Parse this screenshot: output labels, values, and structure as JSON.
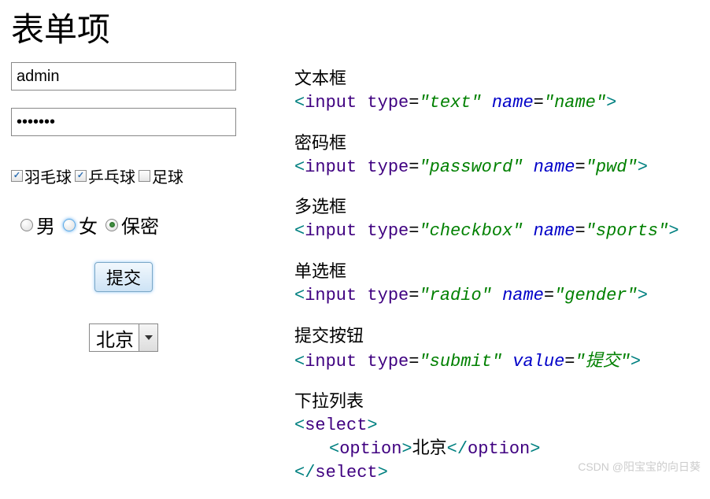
{
  "heading": "表单项",
  "form": {
    "text_value": "admin",
    "password_value": "•••••••",
    "checkboxes": [
      {
        "label": "羽毛球",
        "checked": true
      },
      {
        "label": "乒乓球",
        "checked": true
      },
      {
        "label": "足球",
        "checked": false
      }
    ],
    "radios": [
      {
        "label": "男",
        "state": "none"
      },
      {
        "label": "女",
        "state": "hover"
      },
      {
        "label": "保密",
        "state": "selected"
      }
    ],
    "submit_label": "提交",
    "select_value": "北京"
  },
  "sections": [
    {
      "label": "文本框",
      "code": [
        [
          {
            "t": "angle",
            "v": "<"
          },
          {
            "t": "name",
            "v": "input"
          },
          {
            "t": "plain",
            "v": " "
          },
          {
            "t": "name",
            "v": "type"
          },
          {
            "t": "eq",
            "v": "="
          },
          {
            "t": "val",
            "v": "\"text\""
          },
          {
            "t": "plain",
            "v": " "
          },
          {
            "t": "attr",
            "v": "name"
          },
          {
            "t": "eq",
            "v": "="
          },
          {
            "t": "val",
            "v": "\"name\""
          },
          {
            "t": "angle",
            "v": ">"
          }
        ]
      ]
    },
    {
      "label": "密码框",
      "code": [
        [
          {
            "t": "angle",
            "v": "<"
          },
          {
            "t": "name",
            "v": "input"
          },
          {
            "t": "plain",
            "v": " "
          },
          {
            "t": "name",
            "v": "type"
          },
          {
            "t": "eq",
            "v": "="
          },
          {
            "t": "val",
            "v": "\"password\""
          },
          {
            "t": "plain",
            "v": " "
          },
          {
            "t": "attr",
            "v": "name"
          },
          {
            "t": "eq",
            "v": "="
          },
          {
            "t": "val",
            "v": "\"pwd\""
          },
          {
            "t": "angle",
            "v": ">"
          }
        ]
      ]
    },
    {
      "label": "多选框",
      "code": [
        [
          {
            "t": "angle",
            "v": "<"
          },
          {
            "t": "name",
            "v": "input"
          },
          {
            "t": "plain",
            "v": " "
          },
          {
            "t": "name",
            "v": "type"
          },
          {
            "t": "eq",
            "v": "="
          },
          {
            "t": "val",
            "v": "\"checkbox\""
          },
          {
            "t": "plain",
            "v": " "
          },
          {
            "t": "attr",
            "v": "name"
          },
          {
            "t": "eq",
            "v": "="
          },
          {
            "t": "val",
            "v": "\"sports\""
          },
          {
            "t": "angle",
            "v": ">"
          }
        ]
      ]
    },
    {
      "label": "单选框",
      "code": [
        [
          {
            "t": "angle",
            "v": "<"
          },
          {
            "t": "name",
            "v": "input"
          },
          {
            "t": "plain",
            "v": " "
          },
          {
            "t": "name",
            "v": "type"
          },
          {
            "t": "eq",
            "v": "="
          },
          {
            "t": "val",
            "v": "\"radio\""
          },
          {
            "t": "plain",
            "v": " "
          },
          {
            "t": "attr",
            "v": "name"
          },
          {
            "t": "eq",
            "v": "="
          },
          {
            "t": "val",
            "v": "\"gender\""
          },
          {
            "t": "angle",
            "v": ">"
          }
        ]
      ]
    },
    {
      "label": "提交按钮",
      "code": [
        [
          {
            "t": "angle",
            "v": "<"
          },
          {
            "t": "name",
            "v": "input"
          },
          {
            "t": "plain",
            "v": " "
          },
          {
            "t": "name",
            "v": "type"
          },
          {
            "t": "eq",
            "v": "="
          },
          {
            "t": "val",
            "v": "\"submit\""
          },
          {
            "t": "plain",
            "v": " "
          },
          {
            "t": "attr",
            "v": "value"
          },
          {
            "t": "eq",
            "v": "="
          },
          {
            "t": "val",
            "v": "\""
          },
          {
            "t": "valcn",
            "v": "提交"
          },
          {
            "t": "val",
            "v": "\""
          },
          {
            "t": "angle",
            "v": ">"
          }
        ]
      ]
    },
    {
      "label": "下拉列表",
      "code": [
        [
          {
            "t": "angle",
            "v": "<"
          },
          {
            "t": "name",
            "v": "select"
          },
          {
            "t": "angle",
            "v": ">"
          }
        ],
        [
          {
            "t": "indent",
            "v": ""
          },
          {
            "t": "angle",
            "v": "<"
          },
          {
            "t": "name",
            "v": "option"
          },
          {
            "t": "angle",
            "v": ">"
          },
          {
            "t": "plain",
            "v": "北京"
          },
          {
            "t": "angle",
            "v": "</"
          },
          {
            "t": "name",
            "v": "option"
          },
          {
            "t": "angle",
            "v": ">"
          }
        ],
        [
          {
            "t": "angle",
            "v": "</"
          },
          {
            "t": "name",
            "v": "select"
          },
          {
            "t": "angle",
            "v": ">"
          }
        ]
      ]
    }
  ],
  "watermark": "CSDN @阳宝宝的向日葵"
}
